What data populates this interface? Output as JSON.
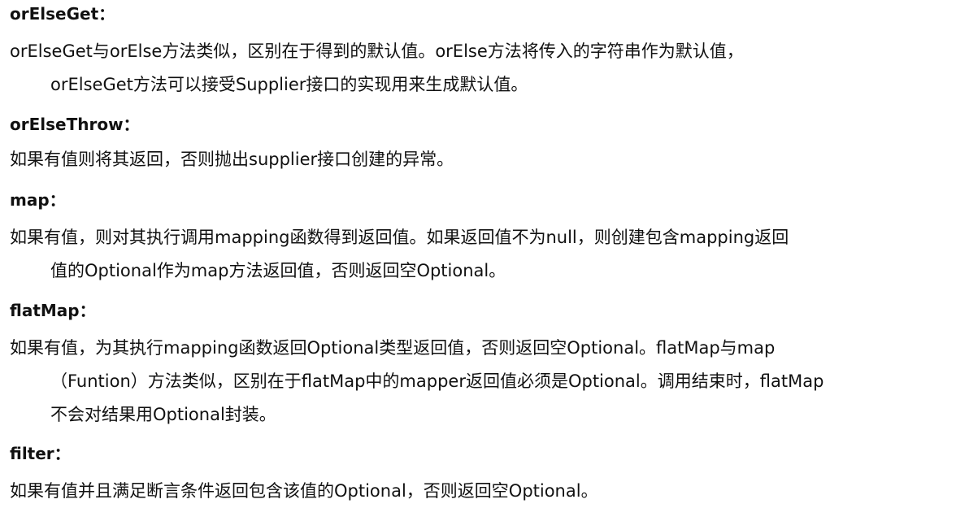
{
  "sections": [
    {
      "heading": "orElseGet：",
      "lines": [
        "orElseGet与orElse方法类似，区别在于得到的默认值。orElse方法将传入的字符串作为默认值，",
        "orElseGet方法可以接受Supplier接口的实现用来生成默认值。"
      ]
    },
    {
      "heading": "orElseThrow：",
      "lines": [
        "如果有值则将其返回，否则抛出supplier接口创建的异常。"
      ]
    },
    {
      "heading": "map：",
      "lines": [
        "如果有值，则对其执行调用mapping函数得到返回值。如果返回值不为null，则创建包含mapping返回",
        "值的Optional作为map方法返回值，否则返回空Optional。"
      ]
    },
    {
      "heading": "flatMap：",
      "lines": [
        "如果有值，为其执行mapping函数返回Optional类型返回值，否则返回空Optional。flatMap与map",
        "（Funtion）方法类似，区别在于flatMap中的mapper返回值必须是Optional。调用结束时，flatMap",
        "不会对结果用Optional封装。"
      ]
    },
    {
      "heading": "filter：",
      "lines": [
        "如果有值并且满足断言条件返回包含该值的Optional，否则返回空Optional。"
      ]
    }
  ]
}
